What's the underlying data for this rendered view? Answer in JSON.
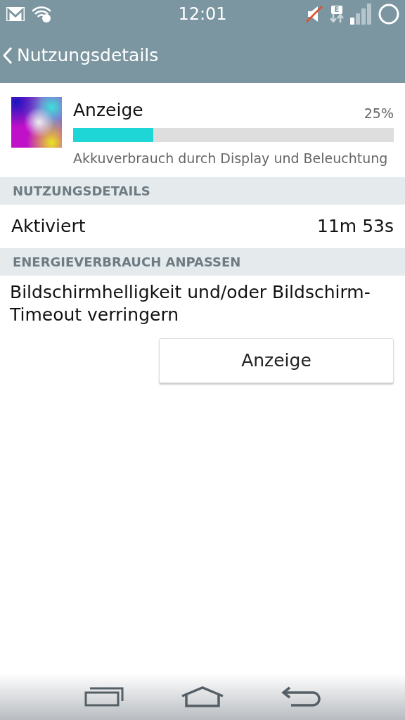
{
  "status_bar": {
    "time": "12:01",
    "network_type": "E"
  },
  "app_bar": {
    "title": "Nutzungsdetails"
  },
  "usage": {
    "name": "Anzeige",
    "percent": "25%",
    "level": 0.25,
    "description": "Akkuverbrauch durch Display und Beleuchtung"
  },
  "sections": [
    {
      "header": "NUTZUNGSDETAILS",
      "kind": "detail",
      "label": "Aktiviert",
      "value": "11m 53s"
    },
    {
      "header": "ENERGIEVERBRAUCH ANPASSEN",
      "kind": "action",
      "text": "Bildschirmhelligkeit und/oder Bildschirm-Timeout verringern",
      "button": "Anzeige"
    }
  ]
}
